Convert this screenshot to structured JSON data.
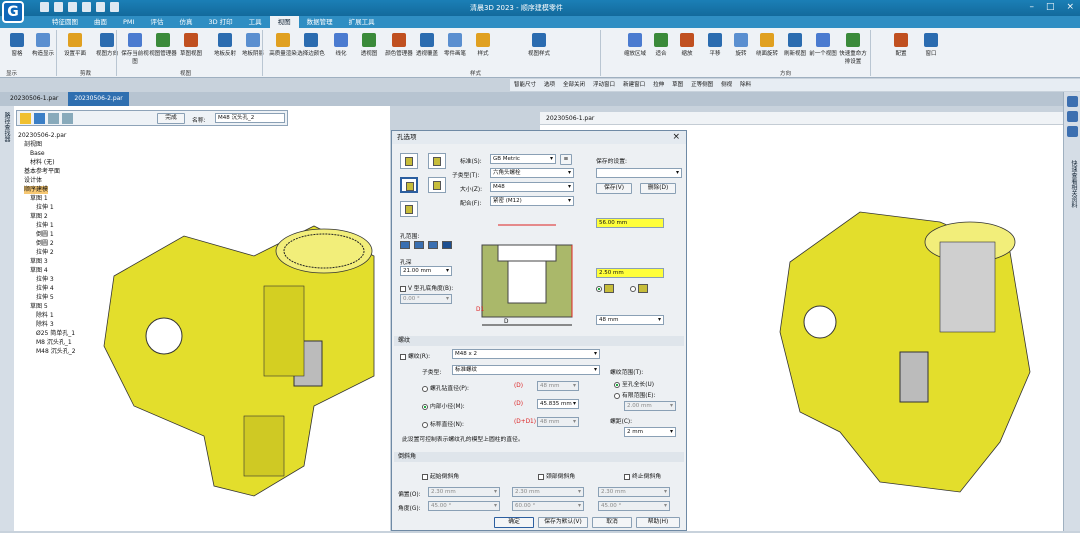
{
  "app": {
    "title": "清晨3D 2023 - 顺序建模零件",
    "logo": "G"
  },
  "tabs": [
    "特征圆图",
    "曲面",
    "PMI",
    "评估",
    "仿真",
    "3D 打印",
    "工具",
    "视图",
    "数据管理",
    "扩展工具"
  ],
  "active_tab": "视图",
  "ribbon": {
    "buttons": [
      "窗格",
      "构造显示",
      "设置平面",
      "视图方向",
      "保存当前视图",
      "视图管理器",
      "草图视图",
      "地板反射",
      "地板阴影",
      "高质量渲染",
      "选择边颜色",
      "线化",
      "透视图",
      "颜色管理器",
      "透视覆盖",
      "零件画笔",
      "样式",
      "视图样式",
      "缩放区域",
      "适合",
      "缩放",
      "平移",
      "旋转",
      "绕面旋转",
      "刷新视图",
      "前一个视图",
      "快速重命方排设置",
      "配置",
      "窗口"
    ],
    "groups": [
      "显示",
      "剪裁",
      "视图",
      "样式",
      "方向"
    ]
  },
  "cmdbar": [
    "智能尺寸",
    "选项",
    "全部关闭",
    "浮动窗口",
    "新建窗口",
    "拉伸",
    "草图",
    "正等侧图",
    "侧视",
    "除料"
  ],
  "doc_tabs": [
    "20230506-1.par",
    "20230506-2.par"
  ],
  "doc_tab_right": "20230506-1.par",
  "left_strip_label": "路径查找器",
  "right_strip_label": "快速查看相关资料",
  "minibar": {
    "finish": "完成",
    "name_label": "名称:",
    "name_value": "M48 沉头孔_2"
  },
  "tree": [
    {
      "t": "20230506-2.par",
      "sel": false
    },
    {
      "t": "剖视图",
      "sel": false
    },
    {
      "t": "Base",
      "sel": false
    },
    {
      "t": "材料 (无)",
      "sel": false
    },
    {
      "t": "基本参考平面",
      "sel": false
    },
    {
      "t": "设计体",
      "sel": false
    },
    {
      "t": "顺序建模",
      "sel": true
    },
    {
      "t": "草图 1",
      "sel": false
    },
    {
      "t": "拉伸 1",
      "sel": false
    },
    {
      "t": "草图 2",
      "sel": false
    },
    {
      "t": "拉伸 1",
      "sel": false
    },
    {
      "t": "倒圆 1",
      "sel": false
    },
    {
      "t": "倒圆 2",
      "sel": false
    },
    {
      "t": "拉伸 2",
      "sel": false
    },
    {
      "t": "草图 3",
      "sel": false
    },
    {
      "t": "草图 4",
      "sel": false
    },
    {
      "t": "拉伸 3",
      "sel": false
    },
    {
      "t": "拉伸 4",
      "sel": false
    },
    {
      "t": "拉伸 5",
      "sel": false
    },
    {
      "t": "草图 5",
      "sel": false
    },
    {
      "t": "除料 1",
      "sel": false
    },
    {
      "t": "除料 3",
      "sel": false
    },
    {
      "t": "Ø25 简单孔_1",
      "sel": false
    },
    {
      "t": "M8 沉头孔_1",
      "sel": false
    },
    {
      "t": "M48 沉头孔_2",
      "sel": false
    }
  ],
  "dialog": {
    "title": "孔选项",
    "standard_label": "标准(S):",
    "standard": "GB Metric",
    "subtype_label": "子类型(T):",
    "subtype": "六角头螺栓",
    "size_label": "大小(Z):",
    "size": "M48",
    "fit_label": "配合(F):",
    "fit": "紧密 (M12)",
    "saved_label": "保存的设置:",
    "save_btn": "保存(V)",
    "delete_btn": "删除(D)",
    "hole_range_label": "孔范围:",
    "depth_label": "孔深",
    "depth": "21.00 mm",
    "vbottom_label": "V 型孔底角度(B):",
    "vbottom": "0.00 °",
    "dim1": "56.00 mm",
    "dim2": "2.50 mm",
    "dim3": "48 mm",
    "d1_label": "D1",
    "d_label": "D",
    "thread_section": "螺纹",
    "thread_cb_label": "螺纹(R):",
    "thread": "M48 x 2",
    "thread_subtype_label": "子类型:",
    "thread_subtype": "标准螺纹",
    "opt1": "螺孔钻直径(P):",
    "opt1_sym": "(D)",
    "opt1_val": "48 mm",
    "opt2": "内部小径(M):",
    "opt2_sym": "(D)",
    "opt2_val": "45.835 mm",
    "opt3": "标称直径(N):",
    "opt3_sym": "(D+D1)",
    "opt3_val": "48 mm",
    "note": "此设置可控制表示螺纹孔的模型上圆柱的直径。",
    "range_label": "螺纹范围(T):",
    "range_full": "至孔全长(U)",
    "range_limited": "有限范围(E):",
    "range_val": "2.00 mm",
    "pitch_label": "螺距(C):",
    "pitch": "2 mm",
    "chamfer_section": "倒斜角",
    "ch1": "起始倒斜角",
    "ch2": "颈部倒斜角",
    "ch3": "终止倒斜角",
    "offset_label": "偏置(O):",
    "angle_label": "角度(G):",
    "off_vals": [
      "2.30 mm",
      "2.30 mm",
      "2.30 mm"
    ],
    "ang_vals": [
      "45.00 °",
      "60.00 °",
      "45.00 °"
    ],
    "ok": "确定",
    "save_default": "保存为默认(V)",
    "cancel": "取消",
    "help": "帮助(H)"
  },
  "colors": {
    "model": "#e3de2c",
    "accent": "#2f8ec3",
    "highlight": "#ffff3a"
  }
}
